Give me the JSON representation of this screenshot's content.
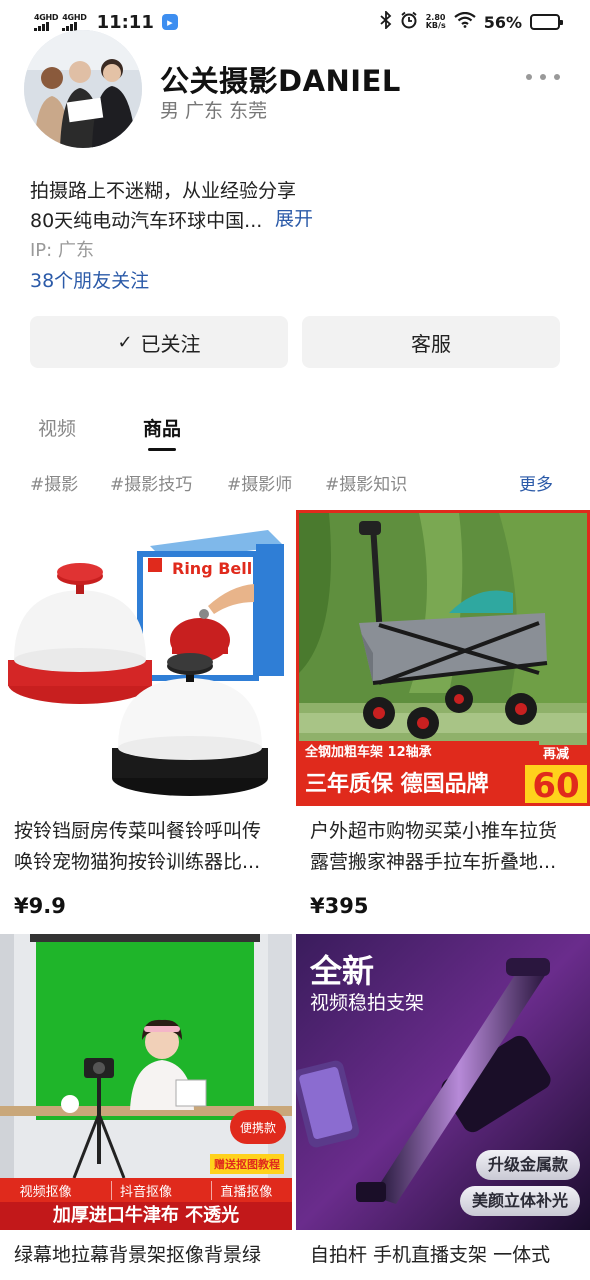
{
  "status_bar": {
    "network_1": "4GHD",
    "network_2": "4GHD",
    "time": "11:11",
    "speed_value": "2.80",
    "speed_unit": "KB/s",
    "battery_percent": "56%",
    "battery_level": 0.56,
    "battery_color": "#f5b800"
  },
  "profile": {
    "name": "公关摄影DANIEL",
    "meta": "男 广东 东莞",
    "bio_line1": "拍摄路上不迷糊，从业经验分享",
    "bio_line2": "80天纯电动汽车环球中国...",
    "expand_label": "展开",
    "ip": "IP: 广东",
    "friends_follow": "38个朋友关注"
  },
  "actions": {
    "follow_label": "已关注",
    "service_label": "客服"
  },
  "tabs": [
    {
      "label": "视频",
      "active": false
    },
    {
      "label": "商品",
      "active": true
    }
  ],
  "tags": [
    "#摄影",
    "#摄影技巧",
    "#摄影师",
    "#摄影知识"
  ],
  "tags_more": "更多",
  "products": [
    {
      "title_line1": "按铃铛厨房传菜叫餐铃呼叫传",
      "title_line2": "唤铃宠物猫狗按铃训练器比...",
      "price": "¥9.9",
      "box_text": "Ring Bell"
    },
    {
      "title_line1": "户外超市购物买菜小推车拉货",
      "title_line2": "露营搬家神器手拉车折叠地...",
      "price": "¥395",
      "banner_top": "全钢加粗车架 12轴承",
      "banner_main": "三年质保 德国品牌",
      "badge_label": "再减",
      "badge_value": "60"
    },
    {
      "title_line1": "绿幕地拉幕背景架抠像背景绿",
      "pill": "便携款",
      "gift": "赠送抠图教程",
      "features": [
        "视频抠像",
        "抖音抠像",
        "直播抠像"
      ],
      "banner_main": "加厚进口牛津布 不透光"
    },
    {
      "title_line1": "自拍杆 手机直播支架 一体式",
      "headline": "全新",
      "subheadline": "视频稳拍支架",
      "pill_1": "升级金属款",
      "pill_2": "美颜立体补光"
    }
  ],
  "colors": {
    "link": "#2b5aa8",
    "promo_red": "#e02a1c",
    "promo_yellow": "#ffd21c",
    "chroma_green": "#1fb52a"
  }
}
